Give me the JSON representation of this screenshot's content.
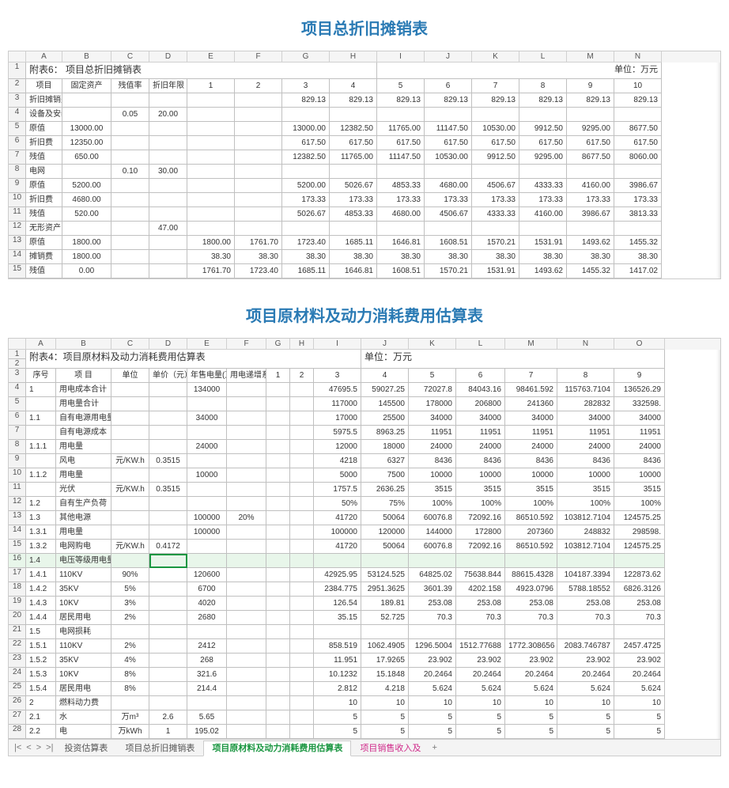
{
  "heading1": "项目总折旧摊销表",
  "heading2": "项目原材料及动力消耗费用估算表",
  "sheet1": {
    "columns": [
      "",
      "A",
      "B",
      "C",
      "D",
      "E",
      "F",
      "G",
      "H",
      "I",
      "J",
      "K",
      "L",
      "M",
      "N"
    ],
    "title_label": "附表6：  项目总折旧摊销表",
    "unit_label": "单位：万元",
    "row_nums": [
      "1",
      "2",
      "3",
      "4",
      "5",
      "6",
      "7",
      "8",
      "9",
      "10",
      "11",
      "12",
      "13",
      "14",
      "15"
    ],
    "headers": [
      "项目",
      "固定资产",
      "残值率",
      "折旧年限",
      "1",
      "2",
      "3",
      "4",
      "5",
      "6",
      "7",
      "8",
      "9",
      "10"
    ],
    "rows": [
      [
        "折旧摊销费",
        "",
        "",
        "",
        "",
        "",
        "829.13",
        "829.13",
        "829.13",
        "829.13",
        "829.13",
        "829.13",
        "829.13",
        "829.13"
      ],
      [
        "设备及安装",
        "",
        "0.05",
        "20.00",
        "",
        "",
        "",
        "",
        "",
        "",
        "",
        "",
        "",
        ""
      ],
      [
        "原值",
        "13000.00",
        "",
        "",
        "",
        "",
        "13000.00",
        "12382.50",
        "11765.00",
        "11147.50",
        "10530.00",
        "9912.50",
        "9295.00",
        "8677.50"
      ],
      [
        "折旧费",
        "12350.00",
        "",
        "",
        "",
        "",
        "617.50",
        "617.50",
        "617.50",
        "617.50",
        "617.50",
        "617.50",
        "617.50",
        "617.50"
      ],
      [
        "残值",
        "650.00",
        "",
        "",
        "",
        "",
        "12382.50",
        "11765.00",
        "11147.50",
        "10530.00",
        "9912.50",
        "9295.00",
        "8677.50",
        "8060.00"
      ],
      [
        "电网",
        "",
        "0.10",
        "30.00",
        "",
        "",
        "",
        "",
        "",
        "",
        "",
        "",
        "",
        ""
      ],
      [
        "原值",
        "5200.00",
        "",
        "",
        "",
        "",
        "5200.00",
        "5026.67",
        "4853.33",
        "4680.00",
        "4506.67",
        "4333.33",
        "4160.00",
        "3986.67"
      ],
      [
        "折旧费",
        "4680.00",
        "",
        "",
        "",
        "",
        "173.33",
        "173.33",
        "173.33",
        "173.33",
        "173.33",
        "173.33",
        "173.33",
        "173.33"
      ],
      [
        "残值",
        "520.00",
        "",
        "",
        "",
        "",
        "5026.67",
        "4853.33",
        "4680.00",
        "4506.67",
        "4333.33",
        "4160.00",
        "3986.67",
        "3813.33"
      ],
      [
        "无形资产",
        "",
        "",
        "47.00",
        "",
        "",
        "",
        "",
        "",
        "",
        "",
        "",
        "",
        ""
      ],
      [
        "原值",
        "1800.00",
        "",
        "",
        "1800.00",
        "1761.70",
        "1723.40",
        "1685.11",
        "1646.81",
        "1608.51",
        "1570.21",
        "1531.91",
        "1493.62",
        "1455.32"
      ],
      [
        "摊销费",
        "1800.00",
        "",
        "",
        "38.30",
        "38.30",
        "38.30",
        "38.30",
        "38.30",
        "38.30",
        "38.30",
        "38.30",
        "38.30",
        "38.30"
      ],
      [
        "残值",
        "0.00",
        "",
        "",
        "1761.70",
        "1723.40",
        "1685.11",
        "1646.81",
        "1608.51",
        "1570.21",
        "1531.91",
        "1493.62",
        "1455.32",
        "1417.02"
      ]
    ]
  },
  "sheet2": {
    "columns": [
      "",
      "A",
      "B",
      "C",
      "D",
      "E",
      "F",
      "G",
      "H",
      "I",
      "J",
      "K",
      "L",
      "M",
      "N",
      "O"
    ],
    "title_label": "附表4：项目原材料及动力消耗费用估算表",
    "unit_label": "单位：万元",
    "row_nums": [
      "1",
      "2",
      "3",
      "4",
      "5",
      "6",
      "7",
      "8",
      "9",
      "10",
      "11",
      "12",
      "13",
      "14",
      "15",
      "16",
      "17",
      "18",
      "19",
      "20",
      "21",
      "22",
      "23",
      "24",
      "25",
      "26",
      "27",
      "28"
    ],
    "headers": [
      "序号",
      "项  目",
      "单位",
      "单价（元）",
      "年售电量(万KW.h)",
      "用电递增系数",
      "1",
      "2",
      "3",
      "4",
      "5",
      "6",
      "7",
      "8",
      "9"
    ],
    "rows": [
      [
        "1",
        "用电成本合计",
        "",
        "",
        "134000",
        "",
        "",
        "",
        "47695.5",
        "59027.25",
        "72027.8",
        "84043.16",
        "98461.592",
        "115763.7104",
        "136526.29"
      ],
      [
        "",
        "用电量合计",
        "",
        "",
        "",
        "",
        "",
        "",
        "117000",
        "145500",
        "178000",
        "206800",
        "241360",
        "282832",
        "332598."
      ],
      [
        "1.1",
        "自有电源用电量合计",
        "",
        "",
        "34000",
        "",
        "",
        "",
        "17000",
        "25500",
        "34000",
        "34000",
        "34000",
        "34000",
        "34000"
      ],
      [
        "",
        "自有电源成本",
        "",
        "",
        "",
        "",
        "",
        "",
        "5975.5",
        "8963.25",
        "11951",
        "11951",
        "11951",
        "11951",
        "11951"
      ],
      [
        "1.1.1",
        "用电量",
        "",
        "",
        "24000",
        "",
        "",
        "",
        "12000",
        "18000",
        "24000",
        "24000",
        "24000",
        "24000",
        "24000"
      ],
      [
        "",
        "风电",
        "元/KW.h",
        "0.3515",
        "",
        "",
        "",
        "",
        "4218",
        "6327",
        "8436",
        "8436",
        "8436",
        "8436",
        "8436"
      ],
      [
        "1.1.2",
        "用电量",
        "",
        "",
        "10000",
        "",
        "",
        "",
        "5000",
        "7500",
        "10000",
        "10000",
        "10000",
        "10000",
        "10000"
      ],
      [
        "",
        "光伏",
        "元/KW.h",
        "0.3515",
        "",
        "",
        "",
        "",
        "1757.5",
        "2636.25",
        "3515",
        "3515",
        "3515",
        "3515",
        "3515"
      ],
      [
        "1.2",
        "自有生产负荷",
        "",
        "",
        "",
        "",
        "",
        "",
        "50%",
        "75%",
        "100%",
        "100%",
        "100%",
        "100%",
        "100%"
      ],
      [
        "1.3",
        "其他电源",
        "",
        "",
        "100000",
        "20%",
        "",
        "",
        "41720",
        "50064",
        "60076.8",
        "72092.16",
        "86510.592",
        "103812.7104",
        "124575.25"
      ],
      [
        "1.3.1",
        "用电量",
        "",
        "",
        "100000",
        "",
        "",
        "",
        "100000",
        "120000",
        "144000",
        "172800",
        "207360",
        "248832",
        "298598."
      ],
      [
        "1.3.2",
        "电网购电",
        "元/KW.h",
        "0.4172",
        "",
        "",
        "",
        "",
        "41720",
        "50064",
        "60076.8",
        "72092.16",
        "86510.592",
        "103812.7104",
        "124575.25"
      ],
      [
        "1.4",
        "电压等级用电量占比",
        "",
        "",
        "",
        "",
        "",
        "",
        "",
        "",
        "",
        "",
        "",
        "",
        ""
      ],
      [
        "1.4.1",
        "110KV",
        "90%",
        "",
        "120600",
        "",
        "",
        "",
        "42925.95",
        "53124.525",
        "64825.02",
        "75638.844",
        "88615.4328",
        "104187.3394",
        "122873.62"
      ],
      [
        "1.4.2",
        "35KV",
        "5%",
        "",
        "6700",
        "",
        "",
        "",
        "2384.775",
        "2951.3625",
        "3601.39",
        "4202.158",
        "4923.0796",
        "5788.18552",
        "6826.3126"
      ],
      [
        "1.4.3",
        "10KV",
        "3%",
        "",
        "4020",
        "",
        "",
        "",
        "126.54",
        "189.81",
        "253.08",
        "253.08",
        "253.08",
        "253.08",
        "253.08"
      ],
      [
        "1.4.4",
        "居民用电",
        "2%",
        "",
        "2680",
        "",
        "",
        "",
        "35.15",
        "52.725",
        "70.3",
        "70.3",
        "70.3",
        "70.3",
        "70.3"
      ],
      [
        "1.5",
        "电网损耗",
        "",
        "",
        "",
        "",
        "",
        "",
        "",
        "",
        "",
        "",
        "",
        "",
        ""
      ],
      [
        "1.5.1",
        "110KV",
        "2%",
        "",
        "2412",
        "",
        "",
        "",
        "858.519",
        "1062.4905",
        "1296.5004",
        "1512.77688",
        "1772.308656",
        "2083.746787",
        "2457.4725"
      ],
      [
        "1.5.2",
        "35KV",
        "4%",
        "",
        "268",
        "",
        "",
        "",
        "11.951",
        "17.9265",
        "23.902",
        "23.902",
        "23.902",
        "23.902",
        "23.902"
      ],
      [
        "1.5.3",
        "10KV",
        "8%",
        "",
        "321.6",
        "",
        "",
        "",
        "10.1232",
        "15.1848",
        "20.2464",
        "20.2464",
        "20.2464",
        "20.2464",
        "20.2464"
      ],
      [
        "1.5.4",
        "居民用电",
        "8%",
        "",
        "214.4",
        "",
        "",
        "",
        "2.812",
        "4.218",
        "5.624",
        "5.624",
        "5.624",
        "5.624",
        "5.624"
      ],
      [
        "2",
        "燃料动力费",
        "",
        "",
        "",
        "",
        "",
        "",
        "10",
        "10",
        "10",
        "10",
        "10",
        "10",
        "10"
      ],
      [
        "2.1",
        "水",
        "万m³",
        "2.6",
        "5.65",
        "",
        "",
        "",
        "5",
        "5",
        "5",
        "5",
        "5",
        "5",
        "5"
      ],
      [
        "2.2",
        "电",
        "万kWh",
        "1",
        "195.02",
        "",
        "",
        "",
        "5",
        "5",
        "5",
        "5",
        "5",
        "5",
        "5"
      ]
    ],
    "tabs": [
      "投资估算表",
      "项目总折旧摊销表",
      "项目原材料及动力消耗费用估算表",
      "项目销售收入及"
    ],
    "active_tab_index": 2,
    "nav": {
      "first": "|<",
      "prev": "<",
      "next": ">",
      "last": ">|",
      "add": "+"
    }
  },
  "chart_data": [
    {
      "type": "table",
      "title": "项目总折旧摊销表",
      "unit": "万元",
      "columns": [
        "项目",
        "固定资产",
        "残值率",
        "折旧年限",
        "1",
        "2",
        "3",
        "4",
        "5",
        "6",
        "7",
        "8",
        "9",
        "10"
      ],
      "rows_ref": "sheet1.rows"
    },
    {
      "type": "table",
      "title": "项目原材料及动力消耗费用估算表",
      "unit": "万元",
      "columns": [
        "序号",
        "项目",
        "单位",
        "单价(元)",
        "年售电量(万KW.h)",
        "用电递增系数",
        "1",
        "2",
        "3",
        "4",
        "5",
        "6",
        "7",
        "8",
        "9"
      ],
      "rows_ref": "sheet2.rows"
    }
  ]
}
